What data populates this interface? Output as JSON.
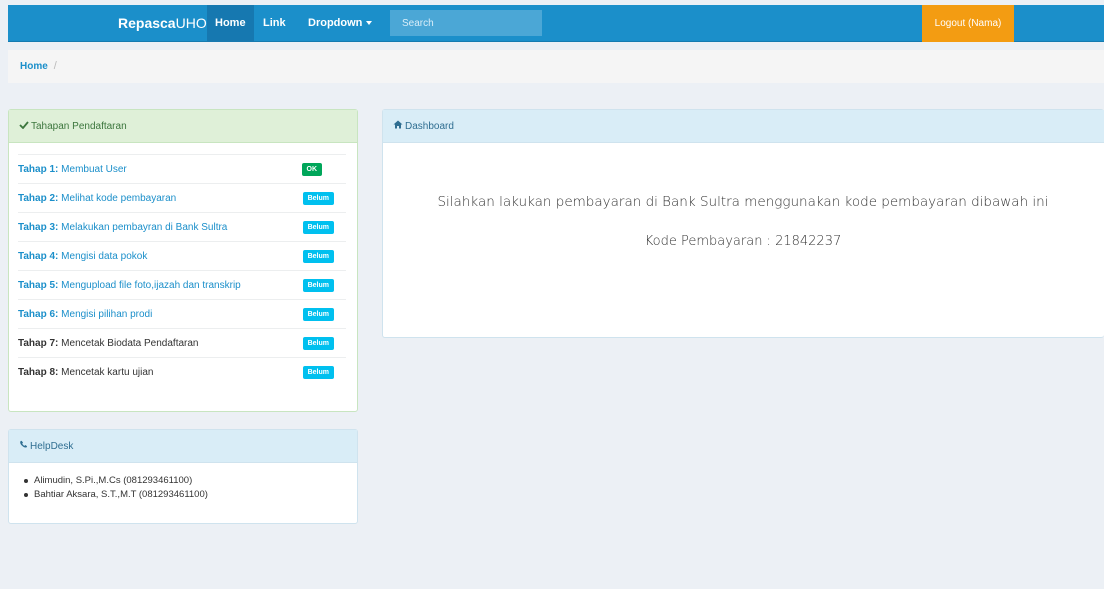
{
  "navbar": {
    "brand_bold": "Repasca",
    "brand_thin": "UHO",
    "items": [
      "Home",
      "Link",
      "Dropdown"
    ],
    "search_placeholder": "Search",
    "logout": "Logout (Nama)"
  },
  "breadcrumb": {
    "home": "Home",
    "separator": "/"
  },
  "tahapan": {
    "title": "Tahapan Pendaftaran",
    "steps": [
      {
        "num": "Tahap 1:",
        "text": "Membuat User",
        "status": "OK"
      },
      {
        "num": "Tahap 2:",
        "text": "Melihat kode pembayaran",
        "status": "Belum"
      },
      {
        "num": "Tahap 3:",
        "text": "Melakukan pembayran di Bank Sultra",
        "status": "Belum"
      },
      {
        "num": "Tahap 4:",
        "text": "Mengisi data pokok",
        "status": "Belum"
      },
      {
        "num": "Tahap 5:",
        "text": "Mengupload file foto,ijazah dan transkrip",
        "status": "Belum"
      },
      {
        "num": "Tahap 6:",
        "text": "Mengisi pilihan prodi",
        "status": "Belum"
      },
      {
        "num": "Tahap 7:",
        "text": "Mencetak Biodata Pendaftaran",
        "status": "Belum"
      },
      {
        "num": "Tahap 8:",
        "text": "Mencetak kartu ujian",
        "status": "Belum"
      }
    ]
  },
  "helpdesk": {
    "title": "HelpDesk",
    "contacts": [
      "Alimudin, S.Pi.,M.Cs (081293461100)",
      "Bahtiar Aksara, S.T.,M.T (081293461100)"
    ]
  },
  "dashboard": {
    "title": "Dashboard",
    "message": "Silahkan lakukan pembayaran di Bank Sultra menggunakan kode pembayaran dibawah ini",
    "code_label": "Kode Pembayaran : 21842237"
  },
  "colors": {
    "primary": "#1b8fca",
    "warning": "#f39c12",
    "success": "#00a65a",
    "info": "#00c0ef"
  }
}
